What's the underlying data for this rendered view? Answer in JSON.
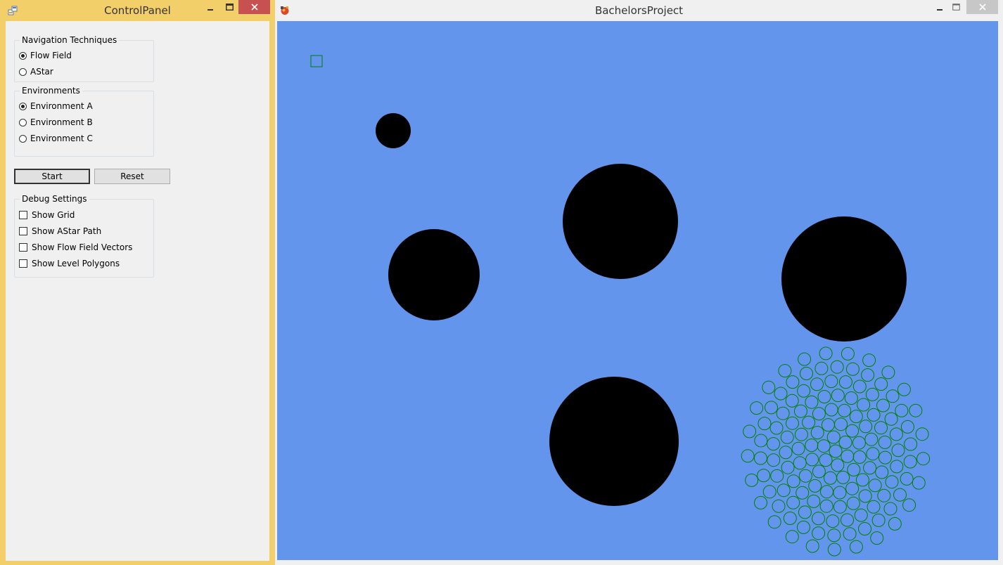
{
  "control_panel": {
    "title": "ControlPanel",
    "icons": {
      "app": "app-icon",
      "minimize": "minimize-icon",
      "maximize": "maximize-icon",
      "close": "close-icon"
    },
    "navigation": {
      "title": "Navigation Techniques",
      "options": [
        {
          "label": "Flow Field",
          "selected": true
        },
        {
          "label": "AStar",
          "selected": false
        }
      ]
    },
    "environments": {
      "title": "Environments",
      "options": [
        {
          "label": "Environment A",
          "selected": true
        },
        {
          "label": "Environment B",
          "selected": false
        },
        {
          "label": "Environment C",
          "selected": false
        }
      ]
    },
    "buttons": {
      "start": "Start",
      "reset": "Reset"
    },
    "debug": {
      "title": "Debug Settings",
      "options": [
        {
          "label": "Show Grid",
          "checked": false
        },
        {
          "label": "Show AStar Path",
          "checked": false
        },
        {
          "label": "Show Flow Field Vectors",
          "checked": false
        },
        {
          "label": "Show Level Polygons",
          "checked": false
        }
      ]
    }
  },
  "game_window": {
    "title": "BachelorsProject",
    "icons": {
      "app": "game-app-icon",
      "minimize": "minimize-icon",
      "maximize": "maximize-icon",
      "close": "close-icon"
    },
    "background_color": "#6495ed",
    "obstacle_color": "#000000",
    "agent_color": "#008000",
    "goal_marker": "green-square-goal"
  }
}
